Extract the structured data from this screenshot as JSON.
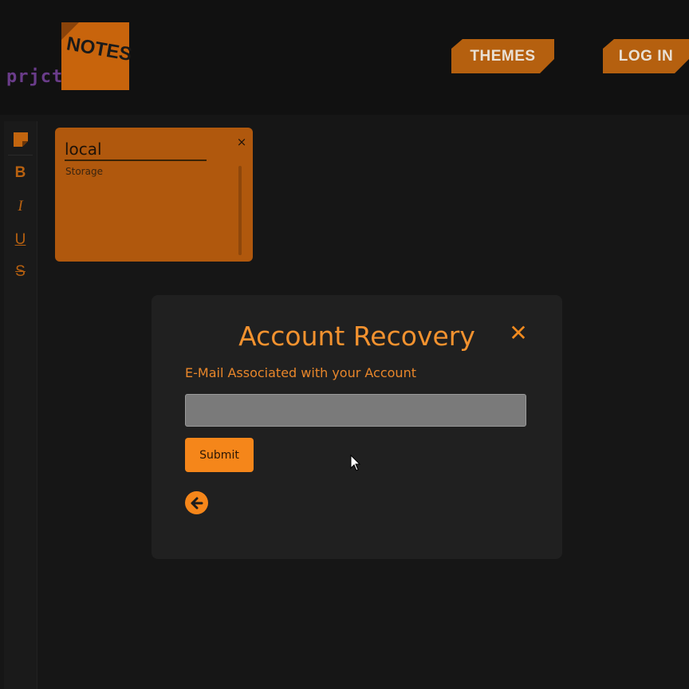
{
  "header": {
    "logo_text": "prjct",
    "logo_note_text": "NOTES",
    "nav": [
      {
        "label": "THEMES"
      },
      {
        "label": "LOG IN"
      }
    ]
  },
  "toolbar": {
    "items": [
      {
        "icon": "sticky-note-icon"
      },
      {
        "label": "B",
        "icon": "bold-icon"
      },
      {
        "label": "I",
        "icon": "italic-icon"
      },
      {
        "label": "U",
        "icon": "underline-icon"
      },
      {
        "label": "S",
        "icon": "strikethrough-icon"
      }
    ]
  },
  "note": {
    "title": "local",
    "body": "Storage",
    "close_label": "×"
  },
  "modal": {
    "title": "Account Recovery",
    "close_label": "✕",
    "email_label": "E-Mail Associated with your Account",
    "email_value": "",
    "email_placeholder": "",
    "submit_label": "Submit",
    "back_icon": "arrow-left-icon"
  },
  "colors": {
    "accent": "#f5861a",
    "note": "#b0580d",
    "background": "#161616",
    "modal": "#202020"
  }
}
